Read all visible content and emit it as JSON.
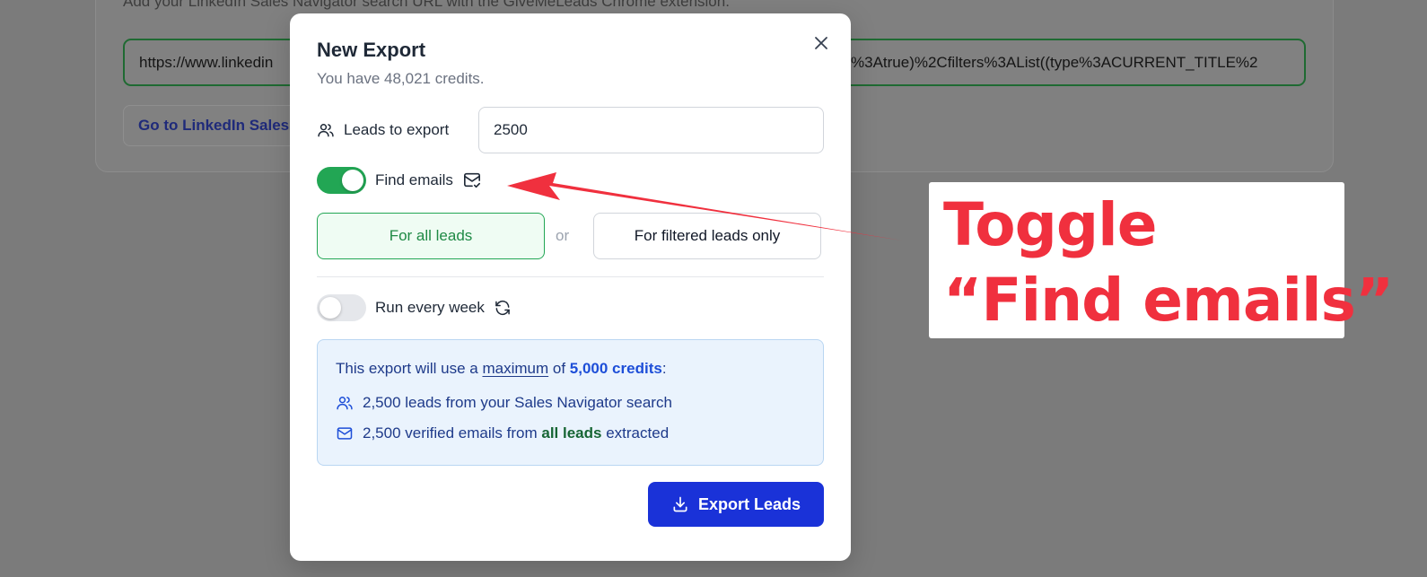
{
  "background": {
    "hint_text": "Add your LinkedIn Sales Navigator search URL with the GiveMeLeads Chrome extension.",
    "url_value_start": "https://www.linkedin",
    "url_value_end": "%3Atrue)%2Cfilters%3AList((type%3ACURRENT_TITLE%2",
    "link_button_label": "Go to LinkedIn Sales"
  },
  "modal": {
    "title": "New Export",
    "subtitle": "You have 48,021 credits.",
    "leads_label": "Leads to export",
    "leads_value": "2500",
    "find_emails_label": "Find emails",
    "find_emails_on": true,
    "scope": {
      "all_label": "For all leads",
      "or_label": "or",
      "filtered_label": "For filtered leads only",
      "selected": "all"
    },
    "run_weekly_label": "Run every week",
    "run_weekly_on": false,
    "summary": {
      "prefix": "This export will use a",
      "maximum": "maximum",
      "of": "of",
      "credits": "5,000 credits",
      "suffix": ":",
      "leads_line": "2,500 leads from your Sales Navigator search",
      "emails_prefix": "2,500 verified emails from",
      "emails_highlight": "all leads",
      "emails_suffix": "extracted"
    },
    "export_button_label": "Export Leads"
  },
  "annotation": {
    "line1": "Toggle",
    "line2": "“Find emails”"
  },
  "colors": {
    "accent_green": "#22a654",
    "primary_blue": "#1a32d8",
    "annotation_red": "#f0303e"
  }
}
